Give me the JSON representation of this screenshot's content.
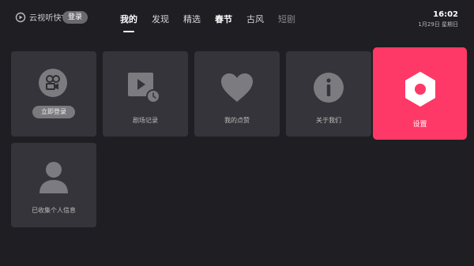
{
  "header": {
    "brand": "云视听快TV",
    "login_pill": "登录",
    "tabs": [
      "我的",
      "发现",
      "精选",
      "春节",
      "古风",
      "短剧"
    ],
    "time": "16:02",
    "date": "1月29日 星期日"
  },
  "cards": {
    "account": {
      "button": "立即登录",
      "icon": "user-video-icon"
    },
    "history": {
      "label": "剧场记录",
      "icon": "play-history-icon"
    },
    "likes": {
      "label": "我的点赞",
      "icon": "heart-icon"
    },
    "about": {
      "label": "关于我们",
      "icon": "info-icon"
    },
    "settings": {
      "label": "设置",
      "icon": "settings-hexagon-icon"
    },
    "personal_info": {
      "label": "已收集个人信息",
      "icon": "person-icon"
    }
  },
  "colors": {
    "background": "#1e1e23",
    "card": "#34343a",
    "accent": "#fe3867",
    "icon_gray": "#7b7b80"
  }
}
